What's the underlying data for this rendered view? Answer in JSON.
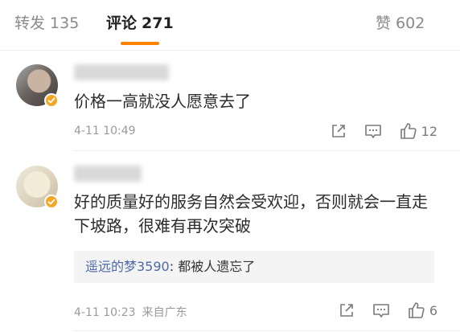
{
  "tabs": {
    "repost": {
      "label": "转发",
      "count": "135"
    },
    "comments": {
      "label": "评论",
      "count": "271"
    },
    "likes": {
      "label": "赞",
      "count": "602"
    }
  },
  "colors": {
    "accent": "#ff8200",
    "link": "#4d6aa8",
    "verified": "#f5a623"
  },
  "comments": [
    {
      "text": "价格一高就没人愿意去了",
      "time": "4-11 10:49",
      "location": "",
      "likes": "12"
    },
    {
      "text": "好的质量好的服务自然会受欢迎，否则就会一直走下坡路，很难有再次突破",
      "time": "4-11 10:23",
      "location": "来自广东",
      "likes": "6",
      "reply": {
        "user": "遥远的梦3590",
        "text": ": 都被人遗忘了"
      }
    }
  ]
}
